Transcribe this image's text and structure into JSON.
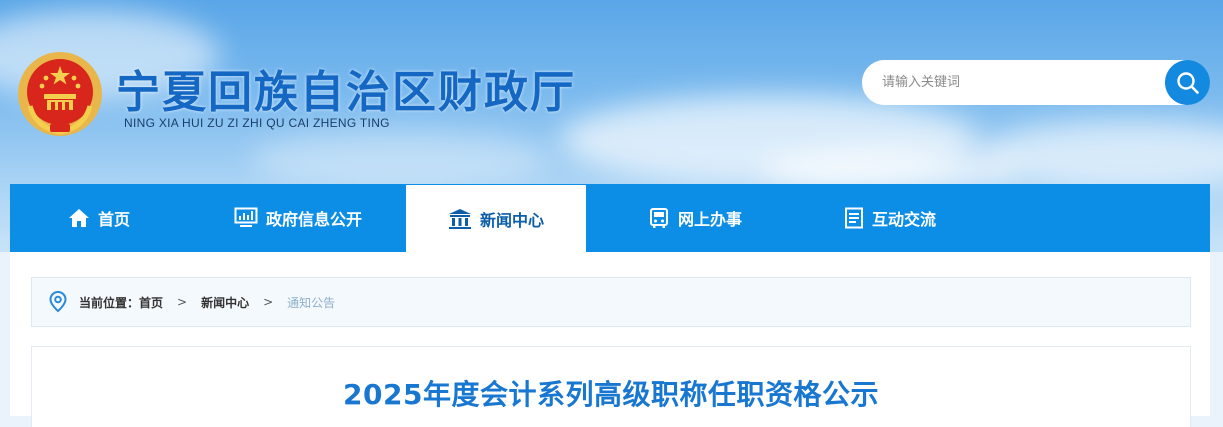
{
  "header": {
    "title": "宁夏回族自治区财政厅",
    "subtitle": "NING XIA HUI ZU ZI ZHI QU CAI ZHENG TING",
    "emblem_icon": "national-emblem-icon"
  },
  "search": {
    "placeholder": "请输入关键词",
    "value": "",
    "icon": "search-icon"
  },
  "nav": {
    "items": [
      {
        "label": "首页",
        "icon": "home-icon",
        "active": false
      },
      {
        "label": "政府信息公开",
        "icon": "monitor-icon",
        "active": false
      },
      {
        "label": "新闻中心",
        "icon": "building-icon",
        "active": true
      },
      {
        "label": "网上办事",
        "icon": "bus-service-icon",
        "active": false
      },
      {
        "label": "互动交流",
        "icon": "document-icon",
        "active": false
      }
    ]
  },
  "breadcrumb": {
    "label": "当前位置：",
    "items": [
      "首页",
      "新闻中心",
      "通知公告"
    ],
    "separator": ">",
    "icon": "location-pin-icon"
  },
  "article": {
    "title": "2025年度会计系列高级职称任职资格公示"
  },
  "colors": {
    "nav_bg": "#0d8ee6",
    "title_blue": "#1468c4",
    "article_title": "#1877d0",
    "search_button": "#1489e0"
  }
}
